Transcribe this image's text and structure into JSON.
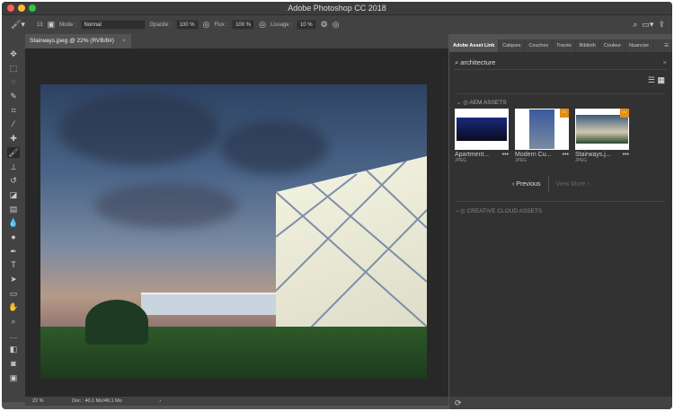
{
  "window": {
    "title": "Adobe Photoshop CC 2018"
  },
  "options": {
    "brush_size": "13",
    "mode_label": "Mode :",
    "mode_value": "Normal",
    "opacity_label": "Opacité :",
    "opacity_value": "100 %",
    "flux_label": "Flux :",
    "flux_value": "100 %",
    "lissage_label": "Lissage :",
    "lissage_value": "10 %"
  },
  "document": {
    "tab": "Stairways.jpeg @ 22% (RVB/8#)",
    "zoom": "22 %",
    "doc_info": "Doc : 40,1 Mo/40,1 Mo"
  },
  "panel": {
    "tabs": [
      "Adobe Asset Link",
      "Calques",
      "Couches",
      "Tracés",
      "Biblioth",
      "Couleur",
      "Nuancier"
    ],
    "search_value": "architecture",
    "aem_section": "AEM ASSETS",
    "cc_section": "CREATIVE CLOUD ASSETS",
    "assets": [
      {
        "name": "Apartment...",
        "type": "JPEG",
        "locked": false
      },
      {
        "name": "Modern Cu...",
        "type": "JPEG",
        "locked": true
      },
      {
        "name": "Stairways.j...",
        "type": "JPEG",
        "locked": true
      }
    ],
    "previous": "Previous",
    "view_more": "View More"
  }
}
